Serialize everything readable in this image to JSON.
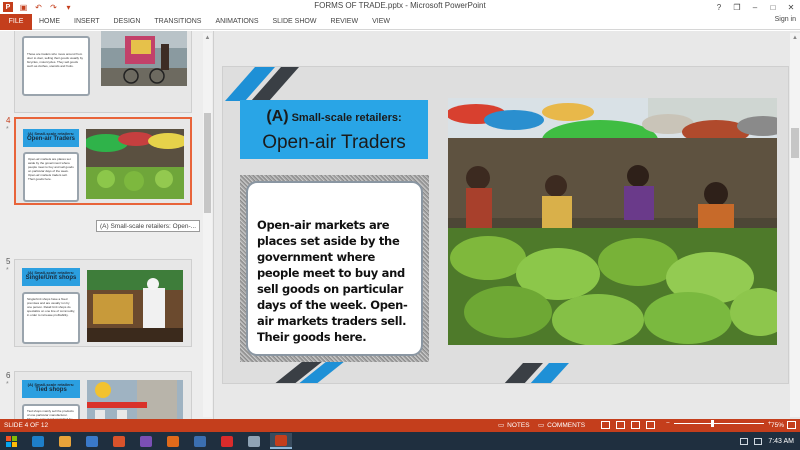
{
  "window": {
    "title": "FORMS OF TRADE.pptx - Microsoft PowerPoint",
    "help": "?",
    "restore_ribbon": "❐",
    "minimize": "–",
    "maximize": "□",
    "close": "✕"
  },
  "qat": {
    "save": "▣",
    "undo": "↶",
    "redo": "↷",
    "customize": "▾"
  },
  "ribbon": {
    "file": "FILE",
    "tabs": [
      "HOME",
      "INSERT",
      "DESIGN",
      "TRANSITIONS",
      "ANIMATIONS",
      "SLIDE SHOW",
      "REVIEW",
      "VIEW"
    ],
    "signin": "Sign in"
  },
  "thumbnails": {
    "slide3_text": "Those are traders who move around from door to door, selling their goods usually by bicycles, motorcycles. They sell goods such as clothes, utensils and fruits.",
    "slide4": {
      "number": "4",
      "star": "*",
      "small": "(A) Small-scale retailers:",
      "big": "Open-air Traders",
      "text": "Open-air markets are places set aside by the government where people meet to buy and sell goods on particular days of the week. Open-air markets traders sell. Their goods here."
    },
    "slide5": {
      "number": "5",
      "star": "*",
      "small": "(A) Small-scale retailers:",
      "big": "Single/Unit shops",
      "text": "Single/Unit shops have a fixed premises and are usually run by one person. Retail Unit shops do specialize on one line of commodity, in order to increase profitability."
    },
    "slide6": {
      "number": "6",
      "star": "*",
      "small": "(A) Small-scale retailers:",
      "big": "Tied shops",
      "text": "Tied shops mainly sell the products of one particular manufacturer. They are owned and controlled by the manufacturer, who designs the shop in organisation and appearance. In Kenya, they include Bata shoes and Shell petrol stations."
    },
    "tooltip": "(A) Small-scale retailers: Open-..."
  },
  "slide": {
    "title_prefix": "(A)",
    "title_small": "Small-scale retailers:",
    "title_big": "Open-air Traders",
    "body": "Open-air markets are places set aside by the government where people meet to buy and sell goods on particular days of the week. Open-air markets traders sell. Their goods here."
  },
  "status": {
    "slide_of": "SLIDE 4 OF 12",
    "notes": "NOTES",
    "comments": "COMMENTS",
    "zoom": "75%",
    "zoom_value": 0.43
  },
  "taskbar": {
    "time": "7:43 AM",
    "apps": [
      "#1e7fc9",
      "#e8a33a",
      "#3a79c9",
      "#d9532b",
      "#7a4fb5",
      "#e06a1b",
      "#3b6fb0",
      "#d92b2b",
      "#8fa3b5",
      "#c43e1c"
    ]
  },
  "colors": {
    "accent": "#c43e1c",
    "title_blue": "#29a5e6",
    "stripe_blue": "#1e90d6",
    "stripe_dark": "#3a3f45"
  }
}
